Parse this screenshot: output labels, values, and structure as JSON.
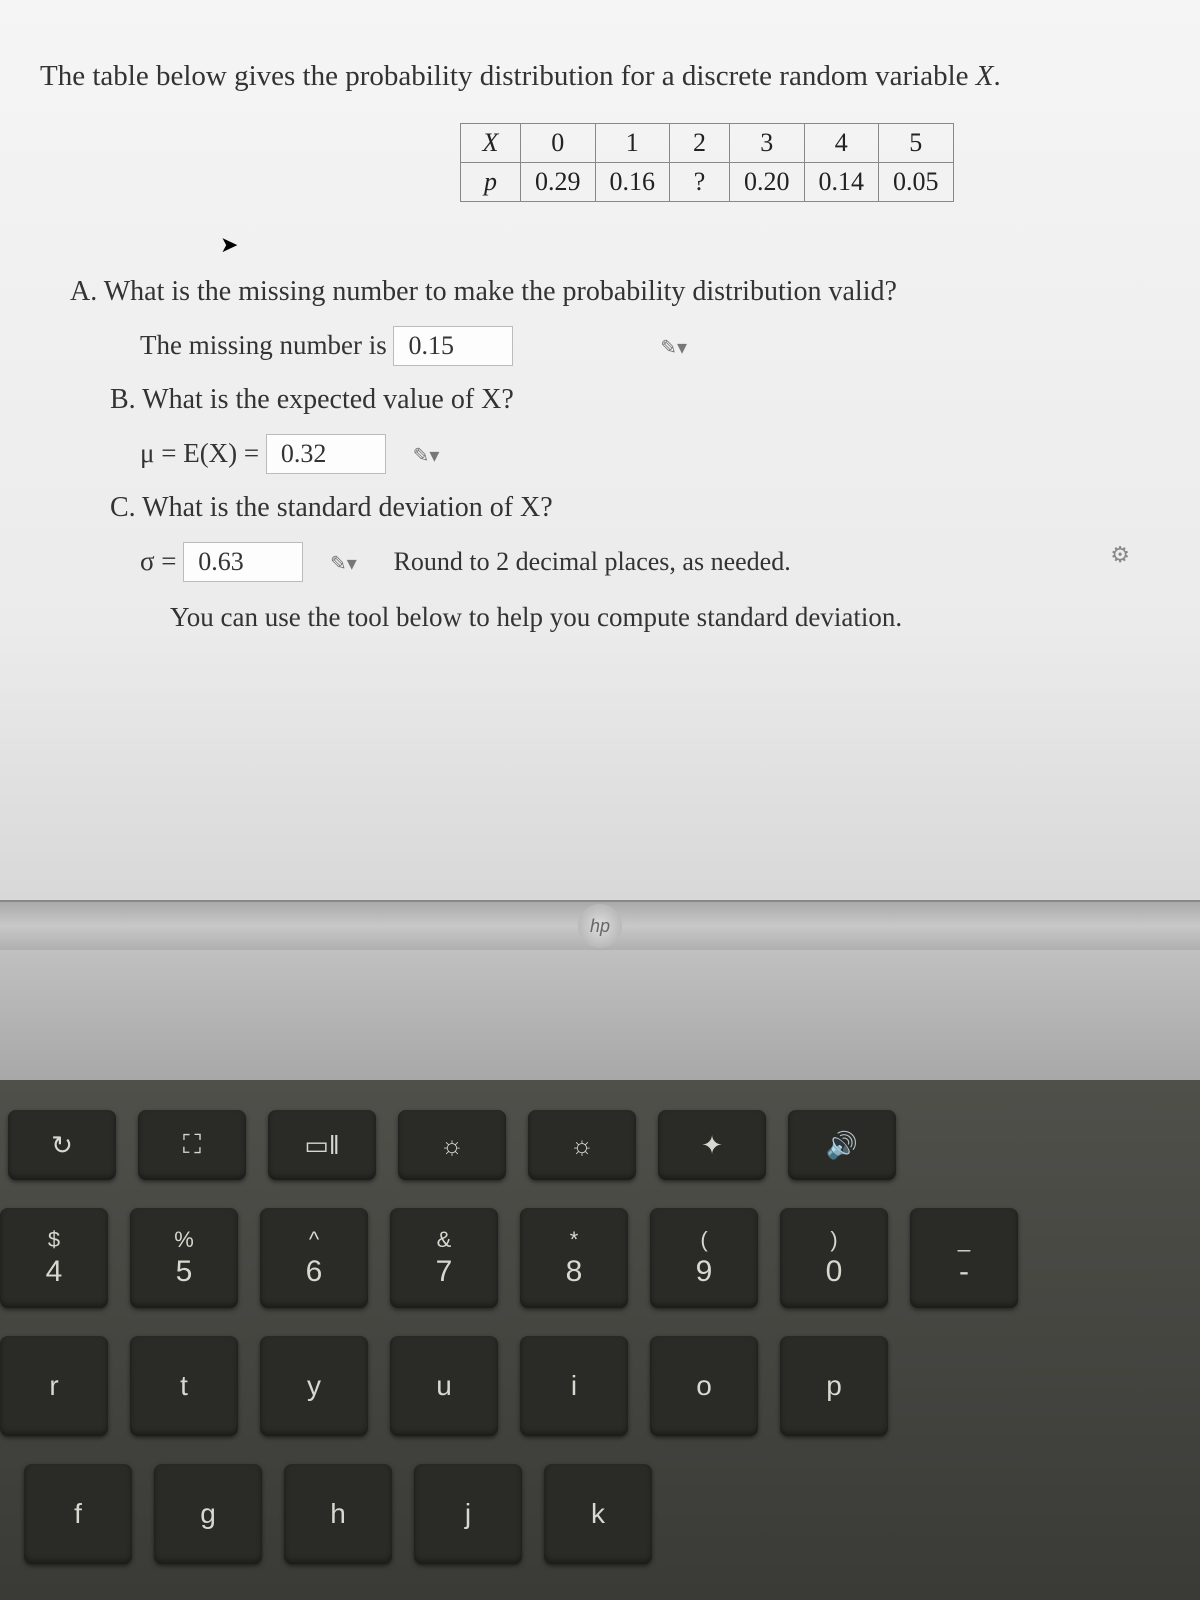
{
  "problem": {
    "intro": "The table below gives the probability distribution for a discrete random variable ",
    "variable": "X",
    "period": ".",
    "table": {
      "row1_label": "X",
      "row1": [
        "0",
        "1",
        "2",
        "3",
        "4",
        "5"
      ],
      "row2_label": "p",
      "row2": [
        "0.29",
        "0.16",
        "?",
        "0.20",
        "0.14",
        "0.05"
      ]
    },
    "partA": "A. What is the missing number to make the probability distribution valid?",
    "partA_label": "The missing number is",
    "partA_answer": "0.15",
    "partB": "B. What is the expected value of X?",
    "partB_prefix": "μ = E(X) =",
    "partB_answer": "0.32",
    "partC": "C. What is the standard deviation of X?",
    "partC_prefix": "σ =",
    "partC_answer": "0.63",
    "partC_hint": "Round to 2 decimal places, as needed.",
    "tool_note": "You can use the tool below to help you compute standard deviation."
  },
  "laptop": {
    "brand": "hp"
  },
  "keyboard": {
    "fn_row": [
      {
        "name": "refresh",
        "label": "↻"
      },
      {
        "name": "fullscreen",
        "label": "⛶"
      },
      {
        "name": "overview",
        "label": "▭‖"
      },
      {
        "name": "brightness-down",
        "label": "☼"
      },
      {
        "name": "brightness-up",
        "label": "☼"
      },
      {
        "name": "keyboard-light",
        "label": "✦"
      },
      {
        "name": "volume",
        "label": "🔊"
      }
    ],
    "num_row": [
      {
        "upper": "$",
        "lower": "4"
      },
      {
        "upper": "%",
        "lower": "5"
      },
      {
        "upper": "^",
        "lower": "6"
      },
      {
        "upper": "&",
        "lower": "7"
      },
      {
        "upper": "*",
        "lower": "8"
      },
      {
        "upper": "(",
        "lower": "9"
      },
      {
        "upper": ")",
        "lower": "0"
      },
      {
        "upper": "_",
        "lower": "-"
      }
    ],
    "qwerty_row": [
      "r",
      "t",
      "y",
      "u",
      "i",
      "o",
      "p"
    ],
    "asdf_row": [
      "f",
      "g",
      "h",
      "j",
      "k"
    ]
  }
}
